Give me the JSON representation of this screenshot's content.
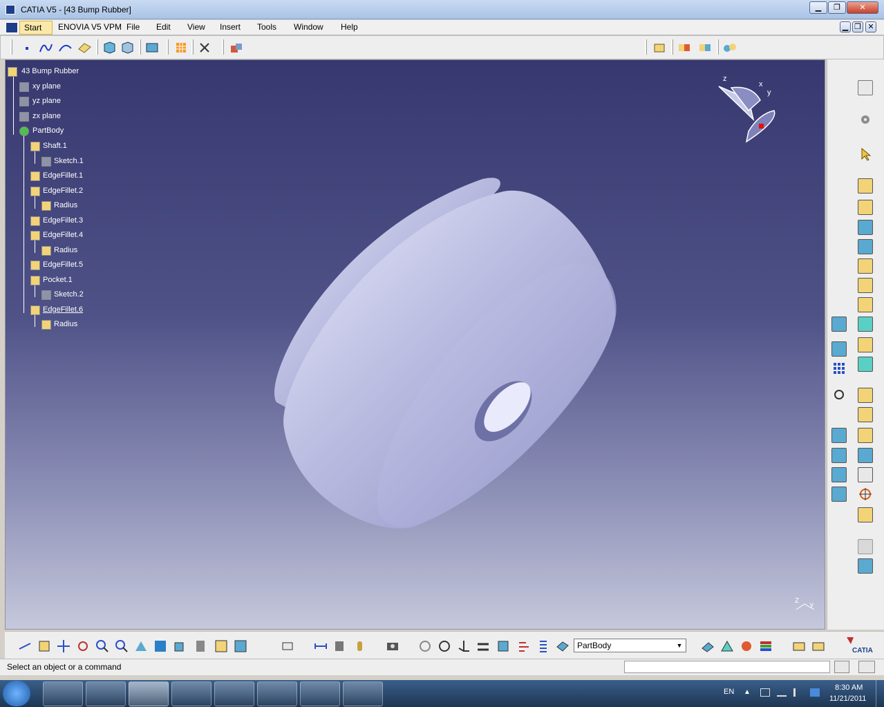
{
  "window": {
    "title": "CATIA V5 - [43 Bump Rubber]",
    "minimize": "▁",
    "restore": "❐",
    "close": "✕"
  },
  "menu": {
    "start": "Start",
    "items": [
      "ENOVIA V5 VPM",
      "File",
      "Edit",
      "View",
      "Insert",
      "Tools",
      "Window",
      "Help"
    ]
  },
  "tree": {
    "root": "43 Bump Rubber",
    "items": [
      {
        "label": "xy plane",
        "icon": "plane-icon"
      },
      {
        "label": "yz plane",
        "icon": "plane-icon"
      },
      {
        "label": "zx plane",
        "icon": "plane-icon"
      },
      {
        "label": "PartBody",
        "icon": "partbody-icon"
      },
      {
        "label": "Shaft.1",
        "icon": "shaft-icon"
      },
      {
        "label": "Sketch.1",
        "icon": "sketch-icon"
      },
      {
        "label": "EdgeFillet.1",
        "icon": "edgefillet-icon"
      },
      {
        "label": "EdgeFillet.2",
        "icon": "edgefillet-icon"
      },
      {
        "label": "Radius",
        "icon": "radius-icon"
      },
      {
        "label": "EdgeFillet.3",
        "icon": "edgefillet-icon"
      },
      {
        "label": "EdgeFillet.4",
        "icon": "edgefillet-icon"
      },
      {
        "label": "Radius",
        "icon": "radius-icon"
      },
      {
        "label": "EdgeFillet.5",
        "icon": "edgefillet-icon"
      },
      {
        "label": "Pocket.1",
        "icon": "pocket-icon"
      },
      {
        "label": "Sketch.2",
        "icon": "sketch-icon"
      },
      {
        "label": "EdgeFillet.6",
        "icon": "edgefillet-icon"
      },
      {
        "label": "Radius",
        "icon": "radius-icon"
      }
    ]
  },
  "compass": {
    "x": "x",
    "y": "y",
    "z": "z"
  },
  "axis_glyph": {
    "z": "Z",
    "y": "y"
  },
  "bottom_toolbar": {
    "current_body": "PartBody",
    "dropdown_arrow": "▼"
  },
  "status": {
    "prompt": "Select an object or a command"
  },
  "taskbar": {
    "language": "EN",
    "time": "8:30 AM",
    "date": "11/21/2011"
  },
  "colors": {
    "viewport_top": "#36386f",
    "viewport_bottom": "#c6c8dc",
    "part_color": "#c7c9ea",
    "highlight": "#fbe9a9"
  }
}
